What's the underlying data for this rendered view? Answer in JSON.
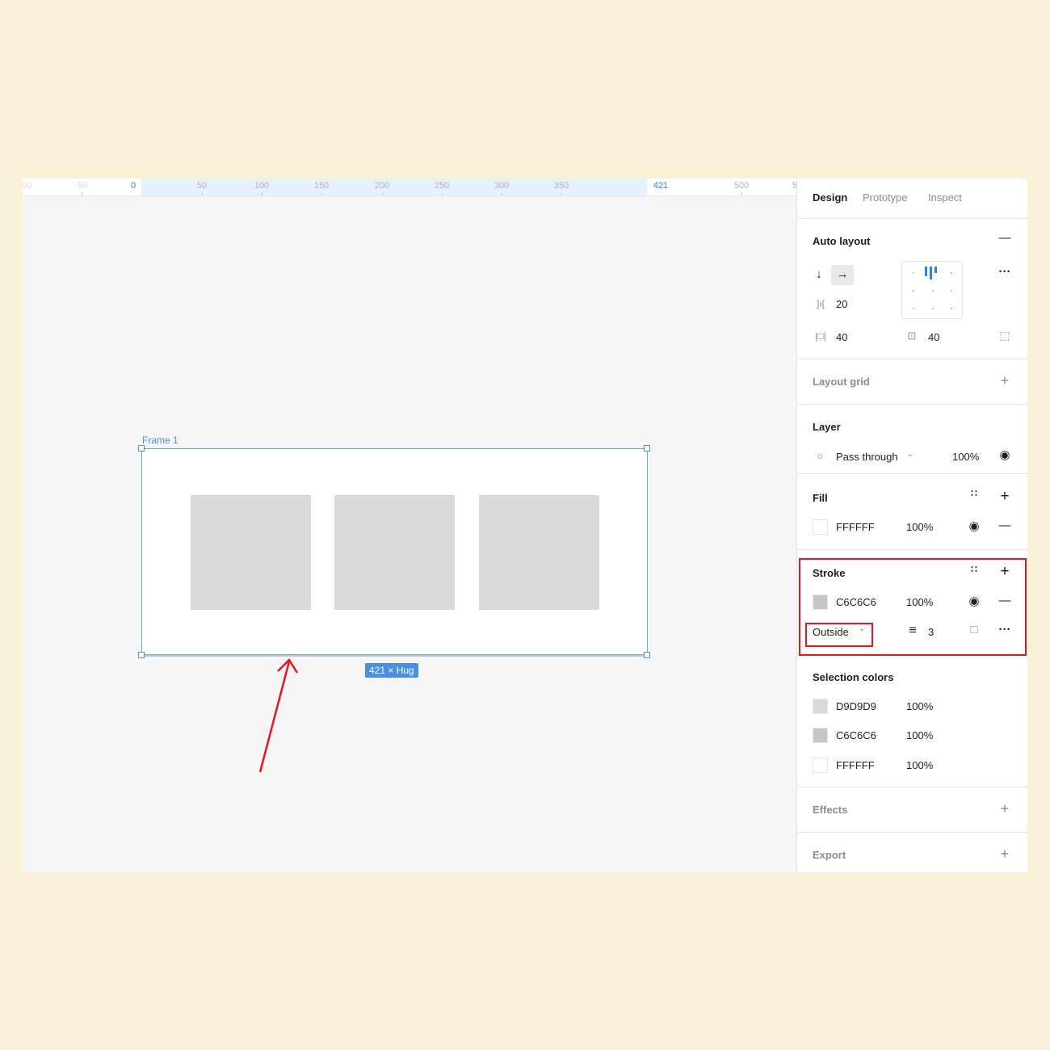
{
  "ruler": {
    "ticks": [
      "00",
      "-50",
      "0",
      "50",
      "100",
      "150",
      "200",
      "250",
      "300",
      "350",
      "421",
      "500",
      "5"
    ]
  },
  "canvas": {
    "frame_name": "Frame 1",
    "size_badge": "421 × Hug",
    "frame_fill": "#FFFFFF",
    "child_fill": "#D9D9D9",
    "selection_color": "#4A90E2"
  },
  "panel": {
    "tabs": [
      "Design",
      "Prototype",
      "Inspect"
    ],
    "auto_layout": {
      "title": "Auto layout",
      "gap": "20",
      "padding_horizontal": "40",
      "padding_vertical": "40"
    },
    "layout_grid": {
      "title": "Layout grid"
    },
    "layer": {
      "title": "Layer",
      "blend_mode": "Pass through",
      "opacity": "100%"
    },
    "fill": {
      "title": "Fill",
      "hex": "FFFFFF",
      "opacity": "100%"
    },
    "stroke": {
      "title": "Stroke",
      "hex": "C6C6C6",
      "opacity": "100%",
      "position": "Outside",
      "weight": "3"
    },
    "selection_colors": {
      "title": "Selection colors",
      "items": [
        {
          "hex": "D9D9D9",
          "opacity": "100%",
          "color": "#D9D9D9"
        },
        {
          "hex": "C6C6C6",
          "opacity": "100%",
          "color": "#C6C6C6"
        },
        {
          "hex": "FFFFFF",
          "opacity": "100%",
          "color": "#FFFFFF"
        }
      ]
    },
    "effects": {
      "title": "Effects"
    },
    "export": {
      "title": "Export"
    }
  },
  "annotation_color": "#E8151C"
}
